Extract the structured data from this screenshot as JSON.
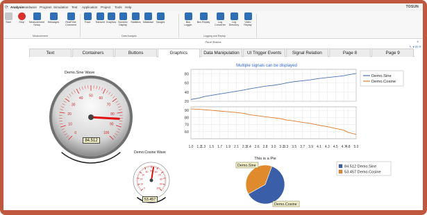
{
  "menu": {
    "items": [
      "Analysis",
      "Hardware",
      "Program",
      "Simulation",
      "Test",
      "Application",
      "Project",
      "Tools",
      "Help"
    ],
    "brand": "TOSUN",
    "quick_access": "⟳"
  },
  "ribbon": {
    "buttons": [
      {
        "label": "Start",
        "color": "#c7c7c7"
      },
      {
        "label": "Stop",
        "color": "#d93030"
      },
      {
        "label": "Measurement Setup",
        "color": "#2f6eb5"
      },
      {
        "label": "Messages",
        "color": "#2f6eb5"
      },
      {
        "label": "RealTime Comment",
        "color": "#2f6eb5"
      },
      {
        "label": "Trace",
        "color": "#2f6eb5"
      },
      {
        "label": "Transmit",
        "color": "#2f6eb5"
      },
      {
        "label": "Graphics",
        "color": "#2f6eb5"
      },
      {
        "label": "Numeric Display",
        "color": "#2f6eb5"
      },
      {
        "label": "Statistics",
        "color": "#2f6eb5"
      },
      {
        "label": "Database",
        "color": "#2f6eb5"
      },
      {
        "label": "Gauges",
        "color": "#2f6eb5"
      },
      {
        "label": "Bus Logger",
        "color": "#2f6eb5"
      },
      {
        "label": "Bus Replay",
        "color": "#2f6eb5"
      },
      {
        "label": "Log Converter",
        "color": "#2f6eb5"
      },
      {
        "label": "Log Directory",
        "color": "#2f6eb5"
      },
      {
        "label": "Video Replay",
        "color": "#2f6eb5"
      }
    ],
    "groups": [
      "Measurement",
      "Data Analysis",
      "Logging and Replay"
    ]
  },
  "panel": {
    "title": "Panel Basics",
    "close": "×",
    "tools": "↖ ▾ ⊟ ⟳"
  },
  "tabs": [
    "Text",
    "Containers",
    "Buttons",
    "Graphics",
    "Data Manipulation",
    "UI Trigger Events",
    "Signal Relation",
    "Page 8",
    "Page 9"
  ],
  "active_tab": "Graphics",
  "gauge1": {
    "title": "Demo.Sine Wave",
    "value": "84.512",
    "level": 84.512,
    "min": 0,
    "max": 100
  },
  "gauge2": {
    "title": "Demo.Cosine Wave",
    "value": "53.457",
    "level": 53.457,
    "min": 0,
    "max": 100
  },
  "chart_data": [
    {
      "type": "line",
      "title": "Multiple signals can be displayed",
      "x": [
        1.0,
        1.2,
        1.3,
        1.5,
        1.7,
        1.9,
        2.1,
        2.3,
        2.4,
        2.6,
        2.8,
        3.0,
        3.2,
        3.3,
        3.5,
        3.7,
        3.9,
        4.1,
        4.3,
        4.5,
        4.7,
        4.8,
        5.0
      ],
      "x_ticks": [
        "1.0",
        "1.2",
        "1.3",
        "1.5",
        "1.7",
        "1.9",
        "2.1",
        "2.3",
        "2.4",
        "2.6",
        "2.8",
        "3.0",
        "3.2",
        "3.3",
        "3.5",
        "3.7",
        "3.9",
        "4.1",
        "4.3",
        "4.5",
        "4.7",
        "4.8",
        "5.0"
      ],
      "series": [
        {
          "name": "Demo.Sine",
          "color": "#4a72b0",
          "values": [
            24,
            27,
            30,
            33,
            36,
            39,
            42,
            45,
            47,
            50,
            53,
            55,
            58,
            60,
            63,
            65,
            67,
            70,
            72,
            74,
            76,
            78,
            81
          ]
        },
        {
          "name": "Demo.Cosine",
          "color": "#e07a2a",
          "values": [
            92,
            91.5,
            91,
            90,
            89,
            88,
            87,
            85.5,
            84,
            82.5,
            81,
            79.5,
            78,
            76.5,
            75,
            73,
            71.5,
            69,
            67,
            64.5,
            62,
            59,
            56
          ]
        }
      ],
      "panels": [
        {
          "ylim": [
            20,
            90
          ],
          "y_ticks": [
            "80",
            "60",
            "40",
            "20"
          ],
          "series": [
            "Demo.Sine"
          ]
        },
        {
          "ylim": [
            50,
            95
          ],
          "y_ticks": [
            "90",
            "80",
            "70",
            "60"
          ],
          "series": [
            "Demo.Cosine"
          ]
        }
      ],
      "legend": "top-right",
      "grid": true
    },
    {
      "type": "pie",
      "title": "This is a Pie",
      "slices": [
        {
          "name": "Demo.Sine",
          "value": 84.512,
          "label": "84.512 Demo.Sine",
          "color": "#3a5ea8"
        },
        {
          "name": "Demo.Cosine",
          "value": 53.457,
          "label": "53.457 Demo.Cosine",
          "color": "#e08a2e"
        }
      ],
      "legend": "right"
    }
  ]
}
